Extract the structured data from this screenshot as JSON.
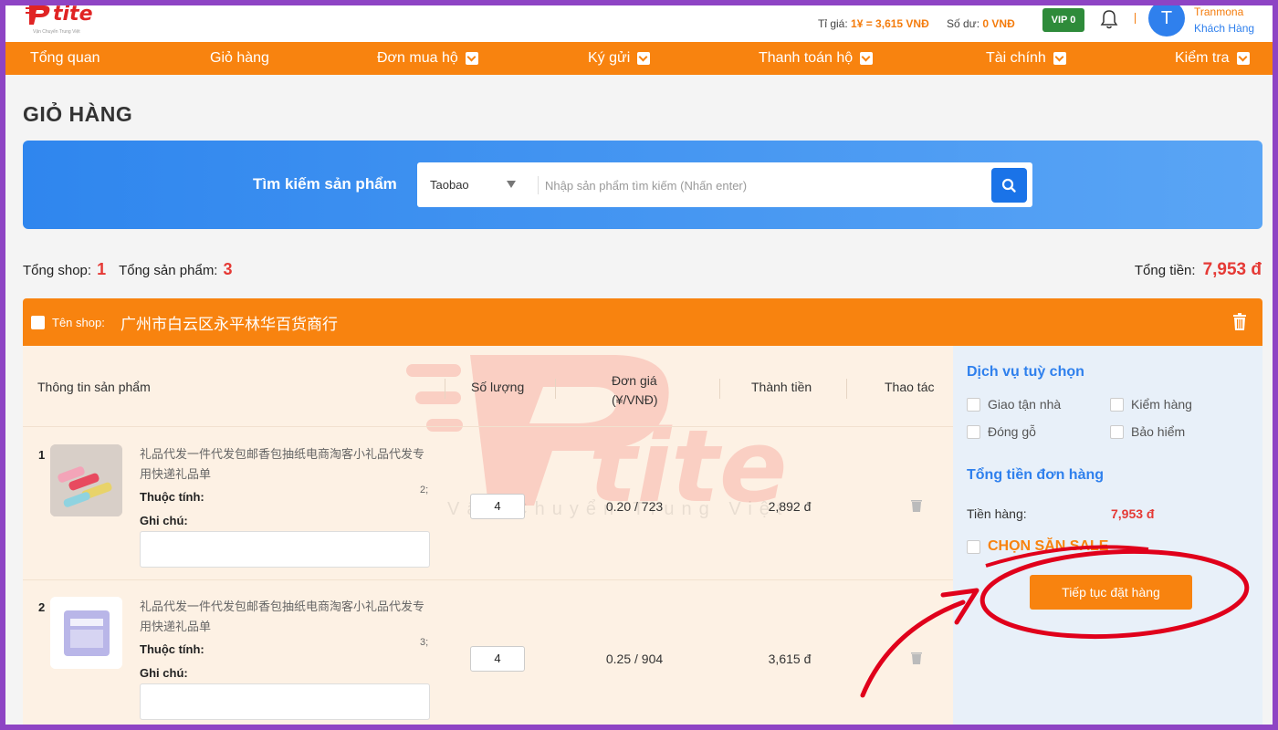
{
  "header": {
    "logo_text": "tite",
    "logo_sub": "Vận Chuyển Trung Việt",
    "rate_label": "Tỉ giá:",
    "rate_value": "1¥ = 3,615 VNĐ",
    "balance_label": "Số dư:",
    "balance_value": "0 VNĐ",
    "vip": "VIP 0",
    "bell_icon": "bell-icon",
    "avatar_initial": "T",
    "user_name": "Tranmona",
    "user_role": "Khách Hàng"
  },
  "nav": {
    "items": [
      {
        "label": "Tổng quan",
        "has_dropdown": false
      },
      {
        "label": "Giỏ hàng",
        "has_dropdown": false
      },
      {
        "label": "Đơn mua hộ",
        "has_dropdown": true
      },
      {
        "label": "Ký gửi",
        "has_dropdown": true
      },
      {
        "label": "Thanh toán hộ",
        "has_dropdown": true
      },
      {
        "label": "Tài chính",
        "has_dropdown": true
      },
      {
        "label": "Kiểm tra",
        "has_dropdown": true
      }
    ]
  },
  "page": {
    "title": "GIỎ HÀNG"
  },
  "search": {
    "label": "Tìm kiếm sản phẩm",
    "source": "Taobao",
    "placeholder": "Nhập sản phẩm tìm kiếm (Nhấn enter)",
    "search_icon": "search-icon"
  },
  "summary": {
    "shops_label": "Tổng shop:",
    "shops_value": "1",
    "products_label": "Tổng sản phẩm:",
    "products_value": "3",
    "total_label": "Tổng tiền:",
    "total_value": "7,953 đ"
  },
  "shop": {
    "label": "Tên shop:",
    "name": "广州市白云区永平林华百货商行",
    "trash_icon": "trash-icon"
  },
  "table": {
    "columns": [
      "Thông tin sản phẩm",
      "Số lượng",
      "Đơn giá\n(¥/VNĐ)",
      "Thành tiền",
      "Thao tác"
    ],
    "col_price_line1": "Đơn giá",
    "col_price_line2": "(¥/VNĐ)",
    "rows": [
      {
        "index": "1",
        "name": "礼品代发一件代发包邮香包抽纸电商淘客小礼品代发专用快递礼品单",
        "attr_label": "Thuộc tính:",
        "attr_value": "2;",
        "note_label": "Ghi chú:",
        "note_value": "",
        "qty": "4",
        "price": "0.20 / 723",
        "amount": "2,892 đ"
      },
      {
        "index": "2",
        "name": "礼品代发一件代发包邮香包抽纸电商淘客小礼品代发专用快递礼品单",
        "attr_label": "Thuộc tính:",
        "attr_value": "3;",
        "note_label": "Ghi chú:",
        "note_value": "",
        "qty": "4",
        "price": "0.25 / 904",
        "amount": "3,615 đ"
      }
    ]
  },
  "watermark": {
    "brand": "tite",
    "tagline": "Vận Chuyển Trung Việt"
  },
  "sidebar": {
    "services_title": "Dịch vụ tuỳ chọn",
    "options": [
      "Giao tận nhà",
      "Kiểm hàng",
      "Đóng gỗ",
      "Bảo hiểm"
    ],
    "order_total_title": "Tổng tiền đơn hàng",
    "goods_label": "Tiền hàng:",
    "goods_value": "7,953 đ",
    "sale_label": "CHỌN SĂN SALE",
    "continue_button": "Tiếp tục đặt hàng"
  },
  "colors": {
    "brand_orange": "#f8830f",
    "brand_blue": "#2f80ed",
    "accent_red": "#e53935",
    "frame_purple": "#8e44c4"
  }
}
